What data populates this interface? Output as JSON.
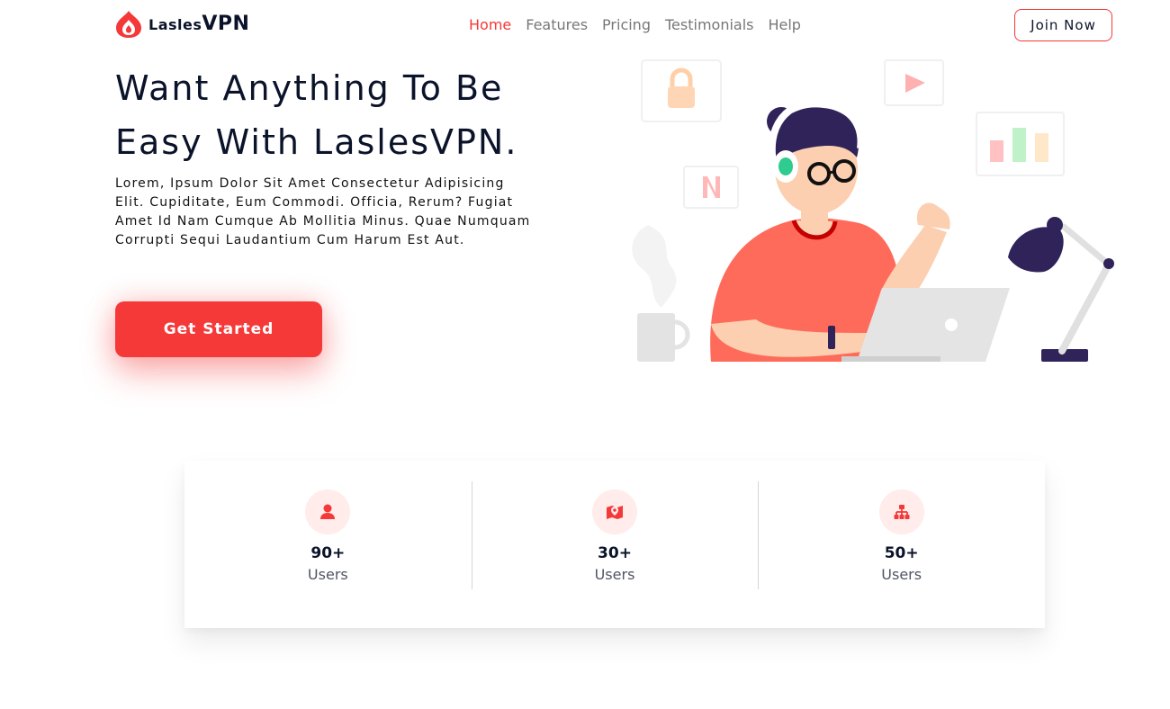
{
  "brand": {
    "name_small": "Lasles",
    "name_big": "VPN"
  },
  "nav": {
    "items": [
      {
        "label": "Home",
        "active": true
      },
      {
        "label": "Features"
      },
      {
        "label": "Pricing"
      },
      {
        "label": "Testimonials"
      },
      {
        "label": "Help"
      }
    ],
    "join_label": "Join Now"
  },
  "hero": {
    "title_line1": "Want Anything To Be",
    "title_line2": "Easy With LaslesVPN.",
    "description": "Lorem, Ipsum Dolor Sit Amet Consectetur Adipisicing Elit. Cupiditate, Eum Commodi. Officia, Rerum? Fugiat Amet Id Nam Cumque Ab Mollitia Minus. Quae Numquam Corrupti Sequi Laudantium Cum Harum Est Aut.",
    "cta_label": "Get Started"
  },
  "stats": [
    {
      "icon": "user-icon",
      "value": "90+",
      "label": "Users"
    },
    {
      "icon": "map-pin-icon",
      "value": "30+",
      "label": "Users"
    },
    {
      "icon": "server-icon",
      "value": "50+",
      "label": "Users"
    }
  ],
  "colors": {
    "accent": "#f53838",
    "dark": "#0b132a",
    "muted": "#4f5665",
    "icon_bg": "#ffeceb"
  }
}
